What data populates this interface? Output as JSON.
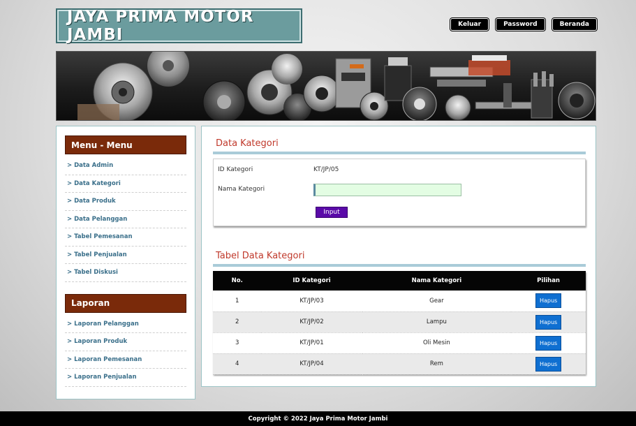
{
  "header": {
    "site_title": "JAYA PRIMA MOTOR JAMBI",
    "nav": [
      "Keluar",
      "Password",
      "Beranda"
    ]
  },
  "banner": {
    "image_semantic": "auto-parts-banner"
  },
  "sidebar": {
    "menu_title": "Menu - Menu",
    "menu_items": [
      "> Data Admin",
      "> Data Kategori",
      "> Data Produk",
      "> Data Pelanggan",
      "> Tabel Pemesanan",
      "> Tabel Penjualan",
      "> Tabel Diskusi"
    ],
    "report_title": "Laporan",
    "report_items": [
      "> Laporan Pelanggan",
      "> Laporan Produk",
      "> Laporan Pemesanan",
      "> Laporan Penjualan"
    ]
  },
  "form": {
    "title": "Data Kategori",
    "id_label": "ID Kategori",
    "id_value": "KT/JP/05",
    "name_label": "Nama Kategori",
    "name_value": "",
    "submit_label": "Input"
  },
  "table": {
    "title": "Tabel Data Kategori",
    "columns": [
      "No.",
      "ID Kategori",
      "Nama Kategori",
      "Pilihan"
    ],
    "rows": [
      {
        "no": "1",
        "id": "KT/JP/03",
        "nama": "Gear",
        "action": "Hapus"
      },
      {
        "no": "2",
        "id": "KT/JP/02",
        "nama": "Lampu",
        "action": "Hapus"
      },
      {
        "no": "3",
        "id": "KT/JP/01",
        "nama": "Oli Mesin",
        "action": "Hapus"
      },
      {
        "no": "4",
        "id": "KT/JP/04",
        "nama": "Rem",
        "action": "Hapus"
      }
    ]
  },
  "footer": {
    "copyright": "Copyright © 2022 Jaya Prima Motor Jambi"
  },
  "colors": {
    "accent_red": "#c0392b",
    "sidebar_head": "#7a2a0a",
    "logo_bg": "#6b9c9e",
    "button_purple": "#5a0aa8",
    "button_blue": "#0f6fd1"
  }
}
